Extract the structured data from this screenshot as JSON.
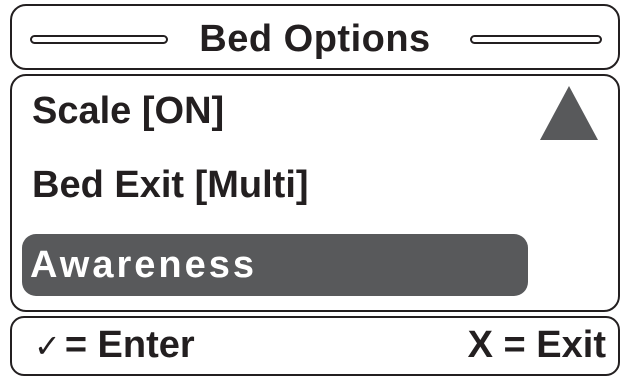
{
  "header": {
    "title": "Bed Options"
  },
  "menu": {
    "items": [
      {
        "label": "Scale [ON]",
        "selected": false
      },
      {
        "label": "Bed Exit [Multi]",
        "selected": false
      },
      {
        "label": "Awareness",
        "selected": true
      }
    ],
    "scroll_icon": "triangle-up-icon",
    "selected_color": "#58595b"
  },
  "footer": {
    "enter_icon": "checkmark-icon",
    "enter_symbol": "✓",
    "enter_label": "= Enter",
    "exit_label": "X = Exit"
  },
  "colors": {
    "ink": "#231f20",
    "highlight": "#58595b",
    "background": "#ffffff"
  }
}
